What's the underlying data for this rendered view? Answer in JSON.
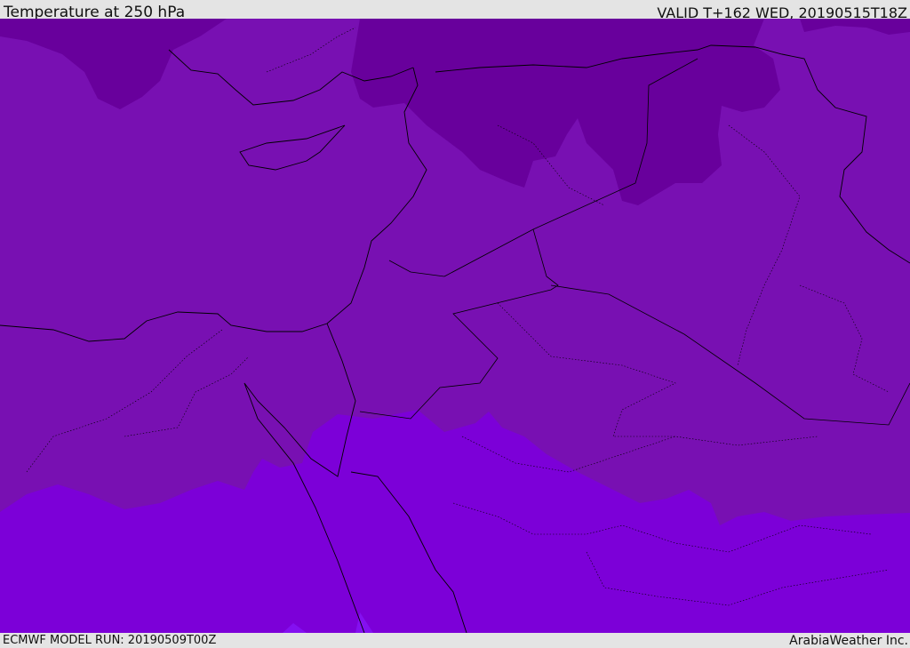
{
  "header": {
    "title": "Temperature at 250 hPa",
    "valid": "VALID T+162 WED, 20190515T18Z"
  },
  "footer": {
    "model_run": "ECMWF MODEL RUN: 20190509T00Z",
    "brand": "ArabiaWeather Inc."
  },
  "map": {
    "variable": "temperature",
    "level_hpa": 250,
    "colors": {
      "cold": "#68009c",
      "mid": "#7810b2",
      "warm": "#7c00d8",
      "warmest": "#8410f0"
    }
  }
}
